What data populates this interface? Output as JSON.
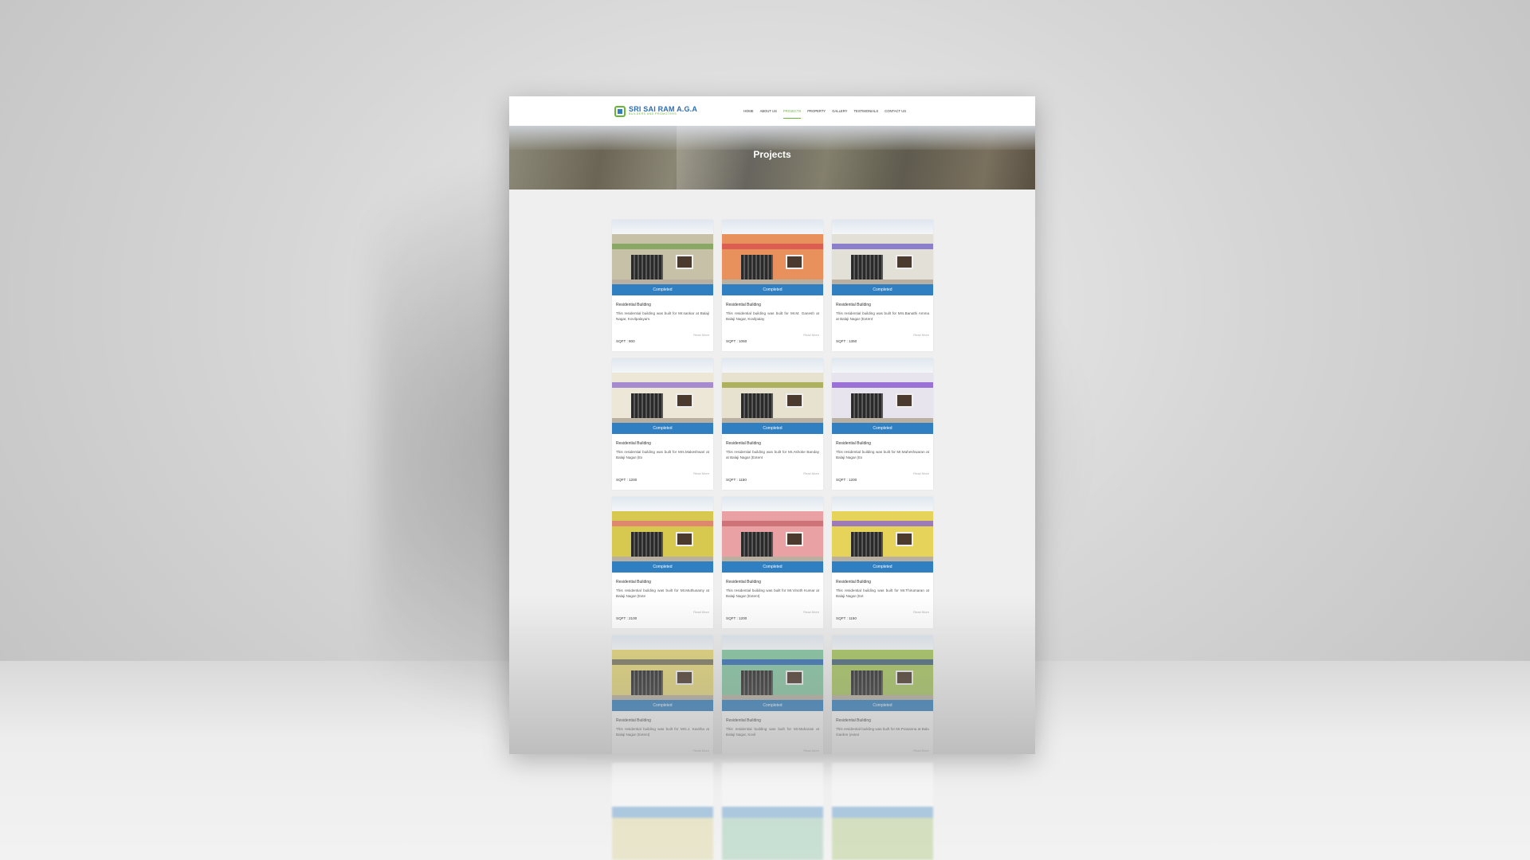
{
  "brand": {
    "name": "SRI SAI RAM A.G.A",
    "tagline": "BUILDERS AND PROMOTERS",
    "accent": "#6bb536",
    "primary": "#2f7fc1"
  },
  "nav": {
    "items": [
      "HOME",
      "ABOUT US",
      "PROJECTS",
      "PROPERTY",
      "GALLERY",
      "TESTIMONIALS",
      "CONTACT US"
    ],
    "active": "PROJECTS"
  },
  "hero": {
    "title": "Projects"
  },
  "cards": [
    {
      "status": "Completed",
      "title": "Residential Building",
      "desc": "This residential building was built for Mr.sankar at Balaji Nagar, Kovilpalayam.",
      "read": "Read More",
      "sqft": "SQFT : 800",
      "wall": "#c7c2a7",
      "band": "#7ea35a"
    },
    {
      "status": "Completed",
      "title": "Residential Building",
      "desc": "This residential building was built for Mr.M. Ganesh at Balaji Nagar, Kovilpalay",
      "read": "Read More",
      "sqft": "SQFT : 1060",
      "wall": "#e9915d",
      "band": "#d9534f"
    },
    {
      "status": "Completed",
      "title": "Residential Building",
      "desc": "This residential building was built for Mrs.Banathi Amma at Balaji Nagar (Extent",
      "read": "Read More",
      "sqft": "SQFT : 1350",
      "wall": "#e3e0d7",
      "band": "#7b6cc9"
    },
    {
      "status": "Completed",
      "title": "Residential Building",
      "desc": "This residential building was built for Mrs.Makeshwari at Balaji Nagar (Ex",
      "read": "Read More",
      "sqft": "SQFT : 1200",
      "wall": "#ece7d6",
      "band": "#9b7ad0"
    },
    {
      "status": "Completed",
      "title": "Residential Building",
      "desc": "This residential building was built for Mr.Ashoke Banday at Balaji Nagar (Extent",
      "read": "Read More",
      "sqft": "SQFT : 1150",
      "wall": "#e6e2cf",
      "band": "#a2a84a"
    },
    {
      "status": "Completed",
      "title": "Residential Building",
      "desc": "This residential building was built for Mr.Maheshwaran at Balaji Nagar (Ex",
      "read": "Read More",
      "sqft": "SQFT : 1200",
      "wall": "#e8e4ee",
      "band": "#8c5ed2"
    },
    {
      "status": "Completed",
      "title": "Residential Building",
      "desc": "This residential building was built for Mr.Muthusamy at Balaji Nagar (Exte",
      "read": "Read More",
      "sqft": "SQFT : 2100",
      "wall": "#d7c84f",
      "band": "#e17b74"
    },
    {
      "status": "Completed",
      "title": "Residential Building",
      "desc": "This residential building was built for Mr.Vinoth Kumar at Balaji Nagar (Extent)",
      "read": "Read More",
      "sqft": "SQFT : 1200",
      "wall": "#e9a1a3",
      "band": "#c96c72"
    },
    {
      "status": "Completed",
      "title": "Residential Building",
      "desc": "This residential building was built for Mr.Thirumaran at Balaji Nagar (Ext",
      "read": "Read More",
      "sqft": "SQFT : 1150",
      "wall": "#e6d45a",
      "band": "#8f6ac9"
    },
    {
      "status": "Completed",
      "title": "Residential Building",
      "desc": "This residential building was built for Mrs.J. Kavitha at Balaji Nagar (Extent)",
      "read": "Read More",
      "sqft": "",
      "wall": "#e5d77a",
      "band": "#6c6a5f"
    },
    {
      "status": "Completed",
      "title": "Residential Building",
      "desc": "This residential building was built for Mr.Maharasi at Balaji Nagar, Kovil",
      "read": "Read More",
      "sqft": "",
      "wall": "#86c7a3",
      "band": "#2d63b8"
    },
    {
      "status": "Completed",
      "title": "Residential Building",
      "desc": "This residential building was built for Mr.Prasanna at Balu Garden (exten",
      "read": "Read More",
      "sqft": "",
      "wall": "#a8c761",
      "band": "#3f5b85"
    }
  ]
}
